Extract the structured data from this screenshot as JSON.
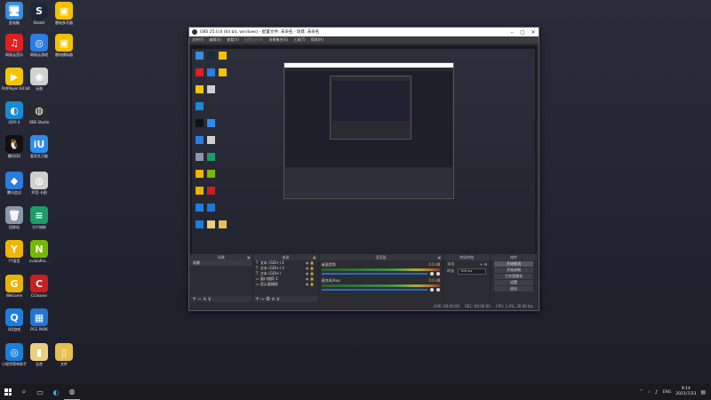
{
  "desktop_icons": [
    {
      "label": "此电脑",
      "color": "#3b8de0",
      "glyph": "🖥"
    },
    {
      "label": "Steam",
      "color": "#1b2838",
      "glyph": "S"
    },
    {
      "label": "雷电多开器",
      "color": "#f2c200",
      "glyph": "▣"
    },
    {
      "label": "网易云音乐",
      "color": "#e02020",
      "glyph": "♫"
    },
    {
      "label": "网易云游戏",
      "color": "#2a7de1",
      "glyph": "◎"
    },
    {
      "label": "雷电模拟器",
      "color": "#f2c200",
      "glyph": "▣"
    },
    {
      "label": "PotPlayer 64 bit",
      "color": "#f5c400",
      "glyph": "▶"
    },
    {
      "label": "无畏",
      "color": "#d0d0d0",
      "glyph": "◉"
    },
    {
      "label": "iQIYI 4",
      "color": "#1a8ad4",
      "glyph": "◐"
    },
    {
      "label": "OBS Studio",
      "color": "#2b2b2b",
      "glyph": "◍"
    },
    {
      "label": "腾讯QQ",
      "color": "#111111",
      "glyph": "🐧"
    },
    {
      "label": "爱奇艺万能",
      "color": "#2d8cf0",
      "glyph": "iU"
    },
    {
      "label": "腾讯会议",
      "color": "#2b7be0",
      "glyph": "◆"
    },
    {
      "label": "声音·卡图",
      "color": "#cfcfcf",
      "glyph": "◍"
    },
    {
      "label": "回收站",
      "color": "#8a98a8",
      "glyph": "🗑"
    },
    {
      "label": "方片抽取",
      "color": "#1a9d6a",
      "glyph": "≡"
    },
    {
      "label": "YY语音",
      "color": "#f2b400",
      "glyph": "Y"
    },
    {
      "label": "nvidiaPro…",
      "color": "#76b900",
      "glyph": "N"
    },
    {
      "label": "WeGame",
      "color": "#e8b400",
      "glyph": "G"
    },
    {
      "label": "CCleaner",
      "color": "#c82020",
      "glyph": "C"
    },
    {
      "label": "QQ游戏",
      "color": "#1f7de0",
      "glyph": "Q"
    },
    {
      "label": "PCG PARK",
      "color": "#2276d2",
      "glyph": "▦"
    },
    {
      "label": "小程序简单助手",
      "color": "#1a7fd8",
      "glyph": "◎"
    },
    {
      "label": "无畏",
      "color": "#e8d080",
      "glyph": "▮"
    },
    {
      "label": "文件",
      "color": "#e8c050",
      "glyph": "▯"
    }
  ],
  "obs": {
    "title": "OBS 25.0.8 (64 bit, windows) - 配置文件: 未命名 - 场景: 未命名",
    "menu": [
      "文件(F)",
      "编辑(E)",
      "查看(V)",
      "配置文件(P)",
      "场景集合(S)",
      "工具(T)",
      "帮助(H)"
    ],
    "docks": {
      "scenes": {
        "title": "场景",
        "items": [
          "场景"
        ]
      },
      "sources": {
        "title": "来源",
        "items": [
          {
            "icon": "T",
            "label": "文本 (GDI+) 2"
          },
          {
            "icon": "T",
            "label": "文本 (GDI+) 3"
          },
          {
            "icon": "T",
            "label": "文本 (GDI+)"
          },
          {
            "icon": "▭",
            "label": "窗口捕获 2"
          },
          {
            "icon": "▭",
            "label": "显示器捕获"
          }
        ]
      },
      "mixer": {
        "title": "混音器",
        "tracks": [
          {
            "name": "桌面音频",
            "db": "0.0 dB"
          },
          {
            "name": "麦克风/Aux",
            "db": "0.0 dB"
          }
        ]
      },
      "transitions": {
        "title": "转场特效",
        "fade": "淡出",
        "duration_label": "时长",
        "duration": "300 ms"
      },
      "controls": {
        "title": "控件",
        "buttons": [
          "开始推流",
          "开始录制",
          "工作室模式",
          "设置",
          "退出"
        ]
      }
    },
    "status": [
      "LIVE: 00:00:00",
      "REC: 00:00:00",
      "CPU: 1.6%, 30.00 fps"
    ]
  },
  "inner_obs_title": "OBS 25.0.8 (64 bit, windows)",
  "taskbar": {
    "search_icon": "search-icon",
    "time": "9:14",
    "date": "2021/7/23",
    "lang": "ENG"
  }
}
